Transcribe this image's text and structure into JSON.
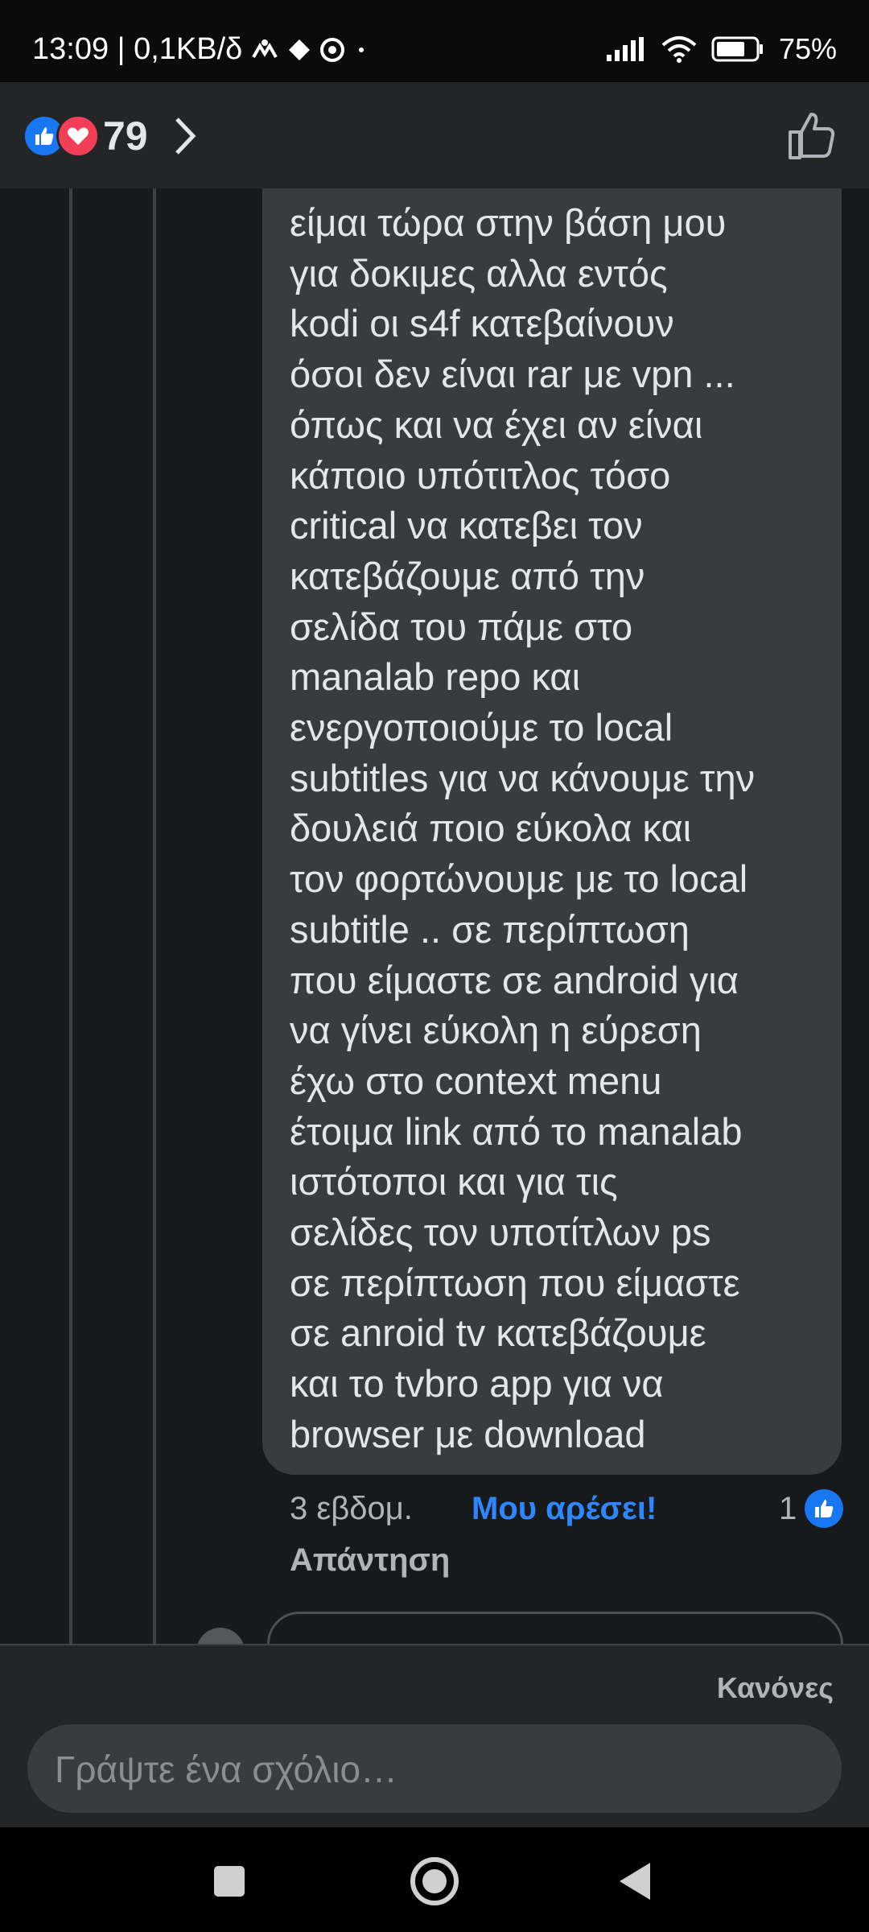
{
  "status_bar": {
    "time_speed": "13:09 | 0,1KB/δ",
    "battery": "75%"
  },
  "reactions": {
    "count": "79"
  },
  "comment": {
    "text": "είμαι τώρα στην βάση μου\nγια δοκιμες αλλα εντός\nkodi οι s4f κατεβαίνουν\nόσοι δεν είναι rar με vpn  ...\nόπως και να έχει  αν είναι\nκάποιο υπότιτλος τόσο\ncritical να κατεβει τον\nκατεβάζουμε  από την\nσελίδα του  πάμε στο\nmanalab repo  και\nενεργοποιούμε το local\nsubtitles για να κάνουμε την\nδουλειά ποιο εύκολα και\nτον φορτώνουμε με το local\nsubtitle ..  σε περίπτωση\nπου είμαστε σε android για\nνα γίνει εύκολη η εύρεση\nέχω στο context menu\nέτοιμα link από το manalab\nιστότοποι και για τις\nσελίδες τον υποτίτλων  ps\nσε περίπτωση που είμαστε\nσε anroid tv κατεβάζουμε\nκαι το tvbro app για να\nbrowser με  download",
    "time": "3 εβδομ.",
    "like_label": "Μου αρέσει!",
    "like_count": "1",
    "reply_label": "Απάντηση"
  },
  "composer": {
    "rules_label": "Κανόνες",
    "placeholder": "Γράψτε ένα σχόλιο…"
  },
  "colors": {
    "background": "#18191a",
    "bubble": "#3a3b3c",
    "accent": "#2d88ff",
    "like": "#1877f2",
    "love": "#f33e58"
  }
}
